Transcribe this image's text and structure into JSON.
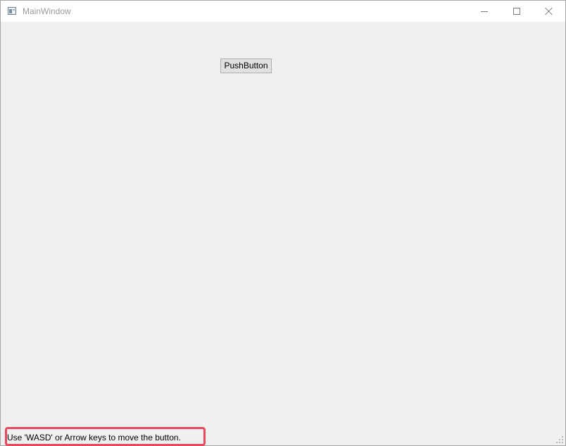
{
  "window": {
    "title": "MainWindow",
    "icon": "app-window-icon",
    "controls": {
      "minimize_icon": "minimize-icon",
      "maximize_icon": "maximize-icon",
      "close_icon": "close-icon"
    }
  },
  "main": {
    "push_button_label": "PushButton"
  },
  "statusbar": {
    "message": "Use 'WASD' or Arrow keys to move the button.",
    "highlight_color": "#e8495c"
  },
  "colors": {
    "title_text": "#999999",
    "client_background": "#f0f0f0",
    "button_background": "#e1e1e1",
    "button_border": "#adadad"
  }
}
